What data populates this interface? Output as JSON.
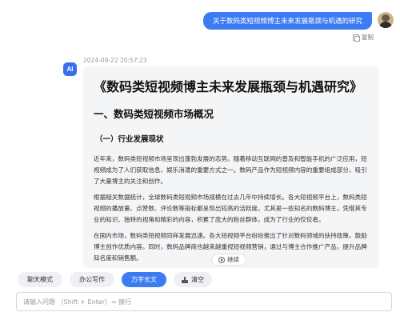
{
  "user_message": {
    "text": "关于数码类短视频博主未来发展瓶颈与机遇的研究",
    "copy_label": "复制"
  },
  "assistant": {
    "avatar_label": "AI",
    "timestamp": "2024-09-22 20:57:23",
    "title": "《数码类短视频博主未来发展瓶颈与机遇研究》",
    "section_heading": "一、数码类短视频市场概况",
    "subsection_heading": "（一）行业发展现状",
    "paragraphs": [
      "近年来，数码类短视频市场呈现出蓬勃发展的态势。随着移动互联网的普及和智能手机的广泛应用，短视频成为了人们获取信息、娱乐消遣的重要方式之一。数码产品作为短视频内容的重要组成部分，吸引了大量博主的关注和创作。",
      "根据相关数据统计，全球数码类短视频市场规模在过去几年中持续增长。各大短视频平台上，数码类短视频的播放量、点赞数、评论数等指标都呈现出较高的活跃度。尤其是一些知名的数码博主，凭借其专业的知识、独特的视角和精彩的内容，积累了庞大的粉丝群体，成为了行业的佼佼者。",
      "在国内市场，数码类短视频同样发展迅速。各大短视频平台纷纷推出了针对数码领域的扶持政策，鼓励博主创作优质内容。同时，数码品牌商也越来越重视短视频营销，通过与博主合作推广产品，提升品牌知名度和销售额。"
    ],
    "continue_label": "继续"
  },
  "modes": {
    "chat": "聊天模式",
    "office": "办公写作",
    "longform": "万字长文",
    "active": "万字长文",
    "clear": "清空"
  },
  "input": {
    "value": "",
    "placeholder": "请输入问题 （Shift + Enter）= 换行"
  },
  "colors": {
    "accent": "#3d7bf2",
    "answer_bg": "#f4f5f7"
  }
}
